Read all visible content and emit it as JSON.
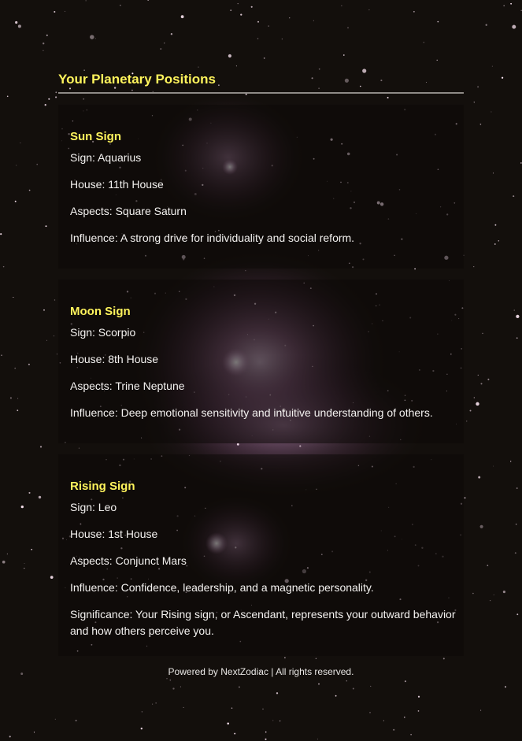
{
  "page": {
    "title": "Your Planetary Positions"
  },
  "sections": [
    {
      "heading": "Sun Sign",
      "lines": [
        "Sign: Aquarius",
        "House: 11th House",
        "Aspects: Square Saturn",
        "Influence: A strong drive for individuality and social reform."
      ]
    },
    {
      "heading": "Moon Sign",
      "lines": [
        "Sign: Scorpio",
        "House: 8th House",
        "Aspects: Trine Neptune",
        "Influence: Deep emotional sensitivity and intuitive understanding of others."
      ]
    },
    {
      "heading": "Rising Sign",
      "lines": [
        "Sign: Leo",
        "House: 1st House",
        "Aspects: Conjunct Mars",
        "Influence: Confidence, leadership, and a magnetic personality.",
        "Significance: Your Rising sign, or Ascendant, represents your outward behavior and how others perceive you."
      ]
    }
  ],
  "footer": {
    "text": "Powered by NextZodiac | All rights reserved."
  },
  "colors": {
    "heading": "#fff45c",
    "background": "#120f0b",
    "nebula": "#b07aa8"
  }
}
